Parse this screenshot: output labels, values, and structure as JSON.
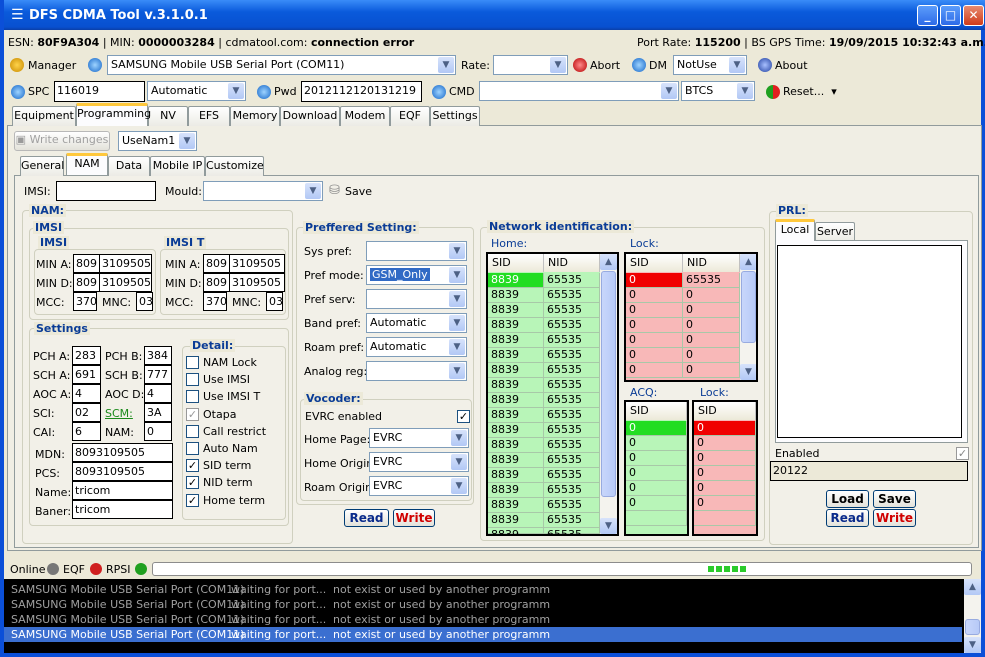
{
  "window": {
    "title": "DFS CDMA Tool v.3.1.0.1"
  },
  "info": {
    "esn_label": "ESN:",
    "esn": "80F9A304",
    "min_label": "| MIN:",
    "min": "0000003284",
    "site_label": "| cdmatool.com:",
    "site_status": "connection error",
    "rate_label": "Port Rate:",
    "rate": "115200",
    "gps_label": "| BS GPS Time:",
    "gps": "19/09/2015 10:32:43 a.m."
  },
  "toolbar1": {
    "manager": "Manager",
    "port": "SAMSUNG Mobile USB Serial Port  (COM11)",
    "rate_label": "Rate:",
    "rate_value": "",
    "abort": "Abort",
    "dm": "DM",
    "dm_value": "NotUse",
    "about": "About"
  },
  "toolbar2": {
    "spc_label": "SPC",
    "spc": "116019",
    "spc_mode": "Automatic",
    "pwd_label": "Pwd",
    "pwd": "2012112120131219",
    "cmd_label": "CMD",
    "cmd_value": "",
    "btcs": "BTCS",
    "reset": "Reset...",
    "reset_arrow": "▾"
  },
  "tabs": [
    "Equipment",
    "Programming",
    "NV",
    "EFS",
    "Memory",
    "Download",
    "Modem",
    "EQF",
    "Settings"
  ],
  "programming": {
    "write_changes": "Write changes",
    "nam_select": "UseNam1",
    "subtabs": [
      "General",
      "NAM",
      "Data",
      "Mobile IP",
      "Customize"
    ]
  },
  "nam_tab": {
    "imsi_label": "IMSI:",
    "imsi_value": "",
    "mould_label": "Mould:",
    "mould_value": "",
    "save": "Save"
  },
  "nam": {
    "title": "NAM:",
    "imsi_group": "IMSI",
    "imsi": {
      "title": "IMSI",
      "min_a_label": "MIN A:",
      "min_a": [
        "809",
        "3109505"
      ],
      "min_d_label": "MIN D:",
      "min_d": [
        "809",
        "3109505"
      ],
      "mcc_label": "MCC:",
      "mcc": "370",
      "mnc_label": "MNC:",
      "mnc": "03"
    },
    "imsi_t": {
      "title": "IMSI T",
      "min_a_label": "MIN A:",
      "min_a": [
        "809",
        "3109505"
      ],
      "min_d_label": "MIN D:",
      "min_d": [
        "809",
        "3109505"
      ],
      "mcc_label": "MCC:",
      "mcc": "370",
      "mnc_label": "MNC:",
      "mnc": "03"
    },
    "settings": {
      "title": "Settings",
      "pch_a_label": "PCH A:",
      "pch_a": "283",
      "pch_b_label": "PCH B:",
      "pch_b": "384",
      "sch_a_label": "SCH A:",
      "sch_a": "691",
      "sch_b_label": "SCH B:",
      "sch_b": "777",
      "aoc_a_label": "AOC A:",
      "aoc_a": "4",
      "aoc_d_label": "AOC D:",
      "aoc_d": "4",
      "sci_label": "SCI:",
      "sci": "02",
      "scm_label": "SCM:",
      "scm": "3A",
      "cai_label": "CAI:",
      "cai": "6",
      "nam_label": "NAM:",
      "nam": "0",
      "mdn_label": "MDN:",
      "mdn": "8093109505",
      "pcs_label": "PCS:",
      "pcs": "8093109505",
      "name_label": "Name:",
      "name": "tricom",
      "baner_label": "Baner:",
      "baner": "tricom"
    },
    "detail": {
      "title": "Detail:",
      "items": [
        {
          "label": "NAM Lock",
          "checked": false
        },
        {
          "label": "Use IMSI",
          "checked": false
        },
        {
          "label": "Use IMSI T",
          "checked": false
        },
        {
          "label": "Otapa",
          "checked": true,
          "disabled": true
        },
        {
          "label": "Call restrict",
          "checked": false
        },
        {
          "label": "Auto Nam",
          "checked": false
        },
        {
          "label": "SID term",
          "checked": true
        },
        {
          "label": "NID term",
          "checked": true
        },
        {
          "label": "Home term",
          "checked": true
        }
      ]
    }
  },
  "preferred": {
    "title": "Preffered Setting:",
    "rows": [
      {
        "label": "Sys pref:",
        "value": ""
      },
      {
        "label": "Pref mode:",
        "value": "GSM_Only",
        "selected": true
      },
      {
        "label": "Pref serv:",
        "value": ""
      },
      {
        "label": "Band pref:",
        "value": "Automatic"
      },
      {
        "label": "Roam pref:",
        "value": "Automatic"
      },
      {
        "label": "Analog reg:",
        "value": ""
      }
    ],
    "vocoder": {
      "title": "Vocoder:",
      "evrc_label": "EVRC enabled",
      "evrc_checked": true,
      "rows": [
        {
          "label": "Home Page:",
          "value": "EVRC"
        },
        {
          "label": "Home Origin:",
          "value": "EVRC"
        },
        {
          "label": "Roam Origin:",
          "value": "EVRC"
        }
      ]
    },
    "read": "Read",
    "write": "Write"
  },
  "network": {
    "title": "Network identification:",
    "home_label": "Home:",
    "lock_label": "Lock:",
    "acq_label": "ACQ:",
    "lock2_label": "Lock:",
    "sid_header": "SID",
    "nid_header": "NID",
    "home": [
      [
        "8839",
        "65535"
      ],
      [
        "8839",
        "65535"
      ],
      [
        "8839",
        "65535"
      ],
      [
        "8839",
        "65535"
      ],
      [
        "8839",
        "65535"
      ],
      [
        "8839",
        "65535"
      ],
      [
        "8839",
        "65535"
      ],
      [
        "8839",
        "65535"
      ],
      [
        "8839",
        "65535"
      ],
      [
        "8839",
        "65535"
      ],
      [
        "8839",
        "65535"
      ],
      [
        "8839",
        "65535"
      ],
      [
        "8839",
        "65535"
      ],
      [
        "8839",
        "65535"
      ],
      [
        "8839",
        "65535"
      ],
      [
        "8839",
        "65535"
      ],
      [
        "8839",
        "65535"
      ],
      [
        "8839",
        "65535"
      ]
    ],
    "lock": [
      [
        "0",
        "65535"
      ],
      [
        "0",
        "0"
      ],
      [
        "0",
        "0"
      ],
      [
        "0",
        "0"
      ],
      [
        "0",
        "0"
      ],
      [
        "0",
        "0"
      ],
      [
        "0",
        "0"
      ]
    ],
    "acq": [
      "0",
      "0",
      "0",
      "0",
      "0",
      "0",
      ""
    ],
    "lock2": [
      "0",
      "0",
      "0",
      "0",
      "0",
      "0",
      ""
    ]
  },
  "prl": {
    "title": "PRL:",
    "tabs": [
      "Local",
      "Server"
    ],
    "enabled_label": "Enabled",
    "enabled": true,
    "value": "20122",
    "load": "Load",
    "save": "Save",
    "read": "Read",
    "write": "Write"
  },
  "status": {
    "online": "Online",
    "eqf": "EQF",
    "rpsi": "RPSI"
  },
  "log": [
    {
      "port": "SAMSUNG Mobile USB Serial Port  (COM11)",
      "state": "waiting for port...",
      "msg": "not exist or used by another programm"
    },
    {
      "port": "SAMSUNG Mobile USB Serial Port  (COM11)",
      "state": "waiting for port...",
      "msg": "not exist or used by another programm"
    },
    {
      "port": "SAMSUNG Mobile USB Serial Port  (COM11)",
      "state": "waiting for port...",
      "msg": "not exist or used by another programm"
    },
    {
      "port": "SAMSUNG Mobile USB Serial Port  (COM11)",
      "state": "waiting for port...",
      "msg": "not exist or used by another programm",
      "selected": true
    }
  ],
  "colors": {
    "accent": "#0A3C96",
    "home_bg": "#B8F5B8",
    "home_sel": "#22DD22",
    "lock_bg": "#F8B8B8",
    "lock_sel": "#F00000",
    "log_bg": "#000000",
    "log_sel": "#3B6FD0"
  }
}
